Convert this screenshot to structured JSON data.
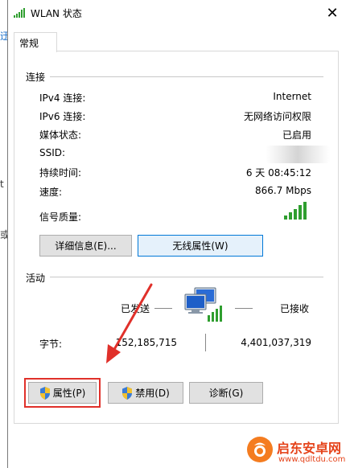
{
  "window": {
    "title": "WLAN 状态",
    "close_glyph": "✕"
  },
  "background_window": {
    "glyphs": [
      "迂",
      "t",
      "或"
    ]
  },
  "tab": {
    "label": "常规"
  },
  "connection": {
    "caption": "连接",
    "rows": [
      {
        "label": "IPv4 连接:",
        "value": "Internet"
      },
      {
        "label": "IPv6 连接:",
        "value": "无网络访问权限"
      },
      {
        "label": "媒体状态:",
        "value": "已启用"
      },
      {
        "label": "SSID:",
        "value": ""
      },
      {
        "label": "持续时间:",
        "value": "6 天 08:45:12"
      },
      {
        "label": "速度:",
        "value": "866.7 Mbps"
      },
      {
        "label": "信号质量:",
        "value": ""
      }
    ],
    "signal_bars": 5,
    "details_button": "详细信息(E)...",
    "wireless_button": "无线属性(W)"
  },
  "activity": {
    "caption": "活动",
    "sent_label": "已发送",
    "received_label": "已接收",
    "bytes_label": "字节:",
    "bytes_sent": "152,185,715",
    "bytes_received": "4,401,037,319"
  },
  "buttons": {
    "properties": "属性(P)",
    "disable": "禁用(D)",
    "diagnose": "诊断(G)"
  },
  "watermark": {
    "name": "启东安卓网",
    "url": "www.qdltdu.com"
  },
  "colors": {
    "highlight": "#e0302a",
    "signal": "#2f9e2f",
    "focus": "#0078d7"
  }
}
